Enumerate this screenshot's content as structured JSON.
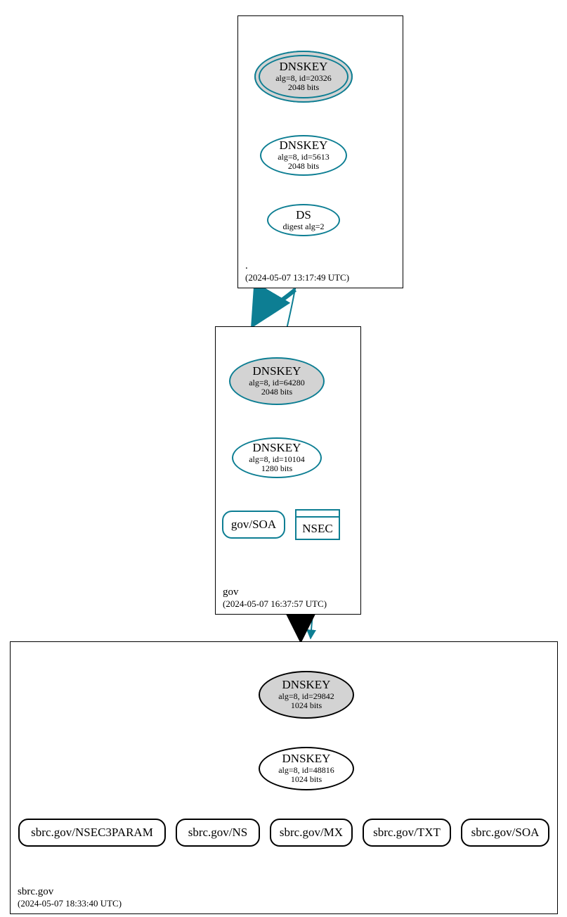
{
  "colors": {
    "teal": "#0d7e93",
    "gray": "#d3d3d3"
  },
  "zones": {
    "root": {
      "name": ".",
      "timestamp": "(2024-05-07 13:17:49 UTC)"
    },
    "gov": {
      "name": "gov",
      "timestamp": "(2024-05-07 16:37:57 UTC)"
    },
    "sbrc": {
      "name": "sbrc.gov",
      "timestamp": "(2024-05-07 18:33:40 UTC)"
    }
  },
  "nodes": {
    "root_ksk": {
      "title": "DNSKEY",
      "line2": "alg=8, id=20326",
      "line3": "2048 bits"
    },
    "root_zsk": {
      "title": "DNSKEY",
      "line2": "alg=8, id=5613",
      "line3": "2048 bits"
    },
    "root_ds": {
      "title": "DS",
      "line2": "digest alg=2"
    },
    "gov_ksk": {
      "title": "DNSKEY",
      "line2": "alg=8, id=64280",
      "line3": "2048 bits"
    },
    "gov_zsk": {
      "title": "DNSKEY",
      "line2": "alg=8, id=10104",
      "line3": "1280 bits"
    },
    "gov_soa": {
      "label": "gov/SOA"
    },
    "gov_nsec": {
      "label": "NSEC"
    },
    "sbrc_ksk": {
      "title": "DNSKEY",
      "line2": "alg=8, id=29842",
      "line3": "1024 bits"
    },
    "sbrc_zsk": {
      "title": "DNSKEY",
      "line2": "alg=8, id=48816",
      "line3": "1024 bits"
    },
    "sbrc_nsec3param": {
      "label": "sbrc.gov/NSEC3PARAM"
    },
    "sbrc_ns": {
      "label": "sbrc.gov/NS"
    },
    "sbrc_mx": {
      "label": "sbrc.gov/MX"
    },
    "sbrc_txt": {
      "label": "sbrc.gov/TXT"
    },
    "sbrc_soa": {
      "label": "sbrc.gov/SOA"
    }
  },
  "chart_data": {
    "type": "graph",
    "description": "DNSSEC authentication chain visualization (dnsviz style)",
    "zones": [
      {
        "name": ".",
        "timestamp": "2024-05-07 13:17:49 UTC"
      },
      {
        "name": "gov",
        "timestamp": "2024-05-07 16:37:57 UTC"
      },
      {
        "name": "sbrc.gov",
        "timestamp": "2024-05-07 18:33:40 UTC"
      }
    ],
    "nodes": [
      {
        "id": "root_ksk",
        "zone": ".",
        "type": "DNSKEY",
        "alg": 8,
        "key_id": 20326,
        "bits": 2048,
        "sep": true,
        "trust_anchor": true
      },
      {
        "id": "root_zsk",
        "zone": ".",
        "type": "DNSKEY",
        "alg": 8,
        "key_id": 5613,
        "bits": 2048
      },
      {
        "id": "root_ds_gov",
        "zone": ".",
        "type": "DS",
        "digest_alg": 2,
        "target_zone": "gov"
      },
      {
        "id": "gov_ksk",
        "zone": "gov",
        "type": "DNSKEY",
        "alg": 8,
        "key_id": 64280,
        "bits": 2048,
        "sep": true
      },
      {
        "id": "gov_zsk",
        "zone": "gov",
        "type": "DNSKEY",
        "alg": 8,
        "key_id": 10104,
        "bits": 1280
      },
      {
        "id": "gov_soa",
        "zone": "gov",
        "type": "RRset",
        "name": "gov/SOA"
      },
      {
        "id": "gov_nsec",
        "zone": "gov",
        "type": "NSEC"
      },
      {
        "id": "sbrc_ksk",
        "zone": "sbrc.gov",
        "type": "DNSKEY",
        "alg": 8,
        "key_id": 29842,
        "bits": 1024,
        "sep": true
      },
      {
        "id": "sbrc_zsk",
        "zone": "sbrc.gov",
        "type": "DNSKEY",
        "alg": 8,
        "key_id": 48816,
        "bits": 1024
      },
      {
        "id": "sbrc_nsec3param",
        "zone": "sbrc.gov",
        "type": "RRset",
        "name": "sbrc.gov/NSEC3PARAM"
      },
      {
        "id": "sbrc_ns",
        "zone": "sbrc.gov",
        "type": "RRset",
        "name": "sbrc.gov/NS"
      },
      {
        "id": "sbrc_mx",
        "zone": "sbrc.gov",
        "type": "RRset",
        "name": "sbrc.gov/MX"
      },
      {
        "id": "sbrc_txt",
        "zone": "sbrc.gov",
        "type": "RRset",
        "name": "sbrc.gov/TXT"
      },
      {
        "id": "sbrc_soa",
        "zone": "sbrc.gov",
        "type": "RRset",
        "name": "sbrc.gov/SOA"
      }
    ],
    "edges": [
      {
        "from": "root_ksk",
        "to": "root_ksk",
        "kind": "self-sign"
      },
      {
        "from": "root_ksk",
        "to": "root_zsk",
        "kind": "signs"
      },
      {
        "from": "root_zsk",
        "to": "root_ds_gov",
        "kind": "signs"
      },
      {
        "from": "root_ds_gov",
        "to": "gov_ksk",
        "kind": "ds-match"
      },
      {
        "from": ".",
        "to": "gov",
        "kind": "delegation"
      },
      {
        "from": "gov_ksk",
        "to": "gov_ksk",
        "kind": "self-sign"
      },
      {
        "from": "gov_ksk",
        "to": "gov_zsk",
        "kind": "signs"
      },
      {
        "from": "gov_zsk",
        "to": "gov_soa",
        "kind": "signs"
      },
      {
        "from": "gov_zsk",
        "to": "gov_nsec",
        "kind": "signs"
      },
      {
        "from": "gov_nsec",
        "to": "sbrc.gov",
        "kind": "nsec-proves"
      },
      {
        "from": "gov",
        "to": "sbrc.gov",
        "kind": "delegation-insecure"
      },
      {
        "from": "sbrc_ksk",
        "to": "sbrc_ksk",
        "kind": "self-sign"
      },
      {
        "from": "sbrc_ksk",
        "to": "sbrc_zsk",
        "kind": "signs"
      },
      {
        "from": "sbrc_zsk",
        "to": "sbrc_zsk",
        "kind": "self-sign"
      },
      {
        "from": "sbrc_zsk",
        "to": "sbrc_nsec3param",
        "kind": "signs"
      },
      {
        "from": "sbrc_zsk",
        "to": "sbrc_ns",
        "kind": "signs"
      },
      {
        "from": "sbrc_zsk",
        "to": "sbrc_mx",
        "kind": "signs"
      },
      {
        "from": "sbrc_zsk",
        "to": "sbrc_txt",
        "kind": "signs"
      },
      {
        "from": "sbrc_zsk",
        "to": "sbrc_soa",
        "kind": "signs"
      }
    ]
  }
}
